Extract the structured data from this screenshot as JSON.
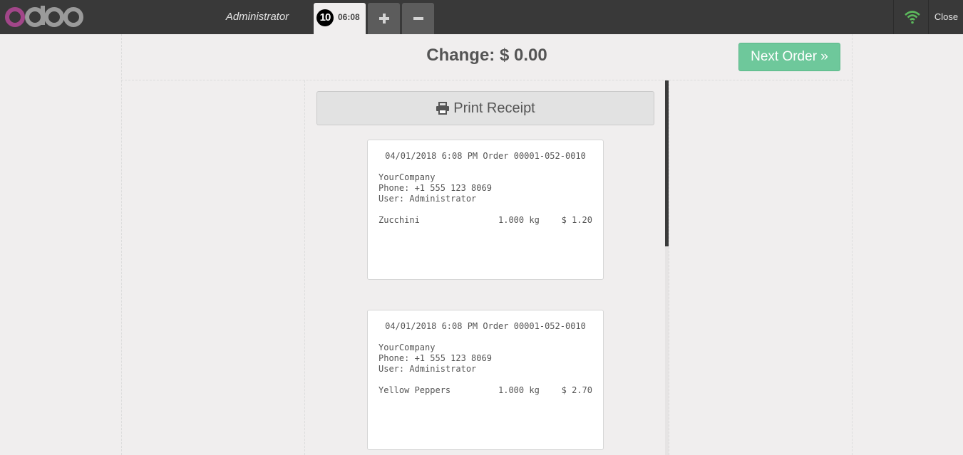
{
  "topbar": {
    "username": "Administrator",
    "order_tab": {
      "sequence": "10",
      "time": "06:08"
    },
    "close_label": "Close"
  },
  "colors": {
    "brand_pink": "#a24689",
    "brand_gray": "#9a9a9a",
    "accent_green": "#6ec89b",
    "wifi_green": "#5cb85c"
  },
  "screen": {
    "change_text": "Change: $ 0.00",
    "next_order_label": "Next Order »",
    "print_receipt_label": "Print Receipt"
  },
  "receipts": [
    {
      "header": "04/01/2018 6:08 PM Order 00001-052-0010",
      "company": "YourCompany",
      "phone": "Phone: +1 555 123 8069",
      "user": "User: Administrator",
      "product": "Zucchini",
      "quantity": "1.000 kg",
      "price": "$ 1.20"
    },
    {
      "header": "04/01/2018 6:08 PM Order 00001-052-0010",
      "company": "YourCompany",
      "phone": "Phone: +1 555 123 8069",
      "user": "User: Administrator",
      "product": "Yellow Peppers",
      "quantity": "1.000 kg",
      "price": "$ 2.70"
    }
  ]
}
